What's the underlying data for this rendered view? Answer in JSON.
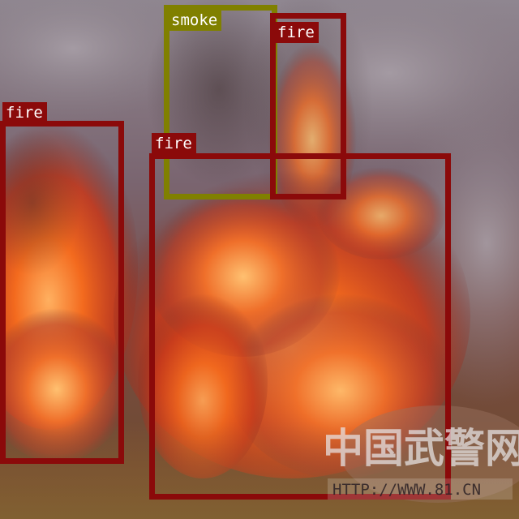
{
  "detections": [
    {
      "label": "fire",
      "color": "#8b0a0a"
    },
    {
      "label": "smoke",
      "color": "#808000"
    },
    {
      "label": "fire",
      "color": "#8b0a0a"
    },
    {
      "label": "fire",
      "color": "#8b0a0a"
    }
  ],
  "watermark": {
    "text": "中国武警网",
    "url": "HTTP://WWW.81.CN"
  },
  "colors": {
    "fire_box": "#8b0a0a",
    "smoke_box": "#808000",
    "label_text": "#ffffff"
  }
}
